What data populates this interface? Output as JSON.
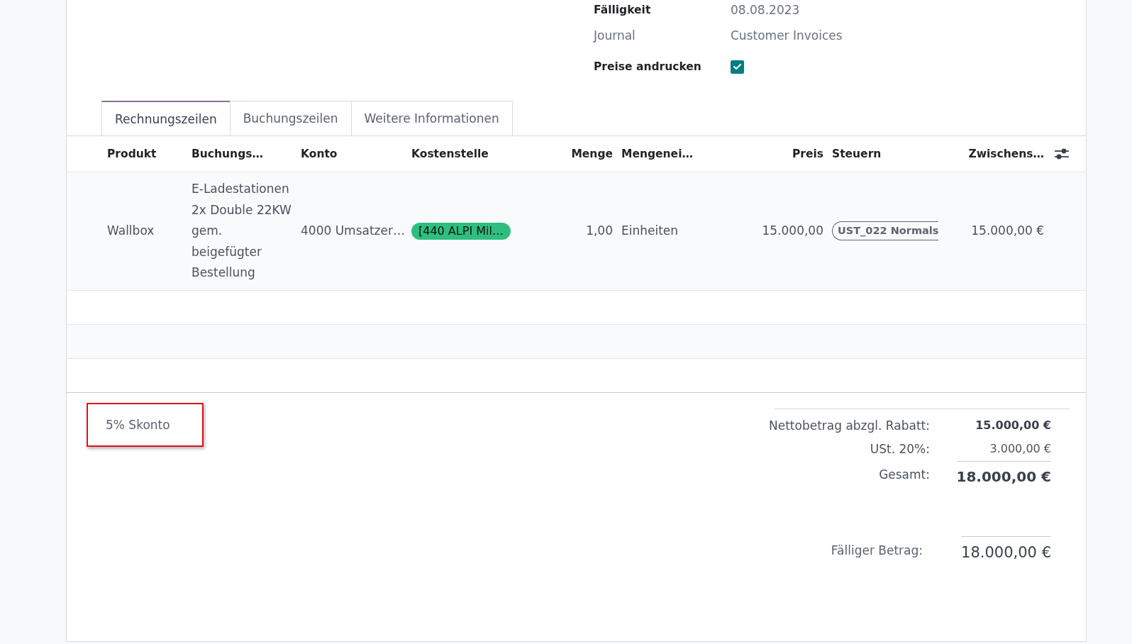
{
  "form_fields": [
    {
      "kind": "text",
      "label": "Fälligkeit",
      "value": "08.08.2023",
      "readonly": false
    },
    {
      "kind": "text",
      "label": "Journal",
      "value": "Customer Invoices",
      "readonly": true
    },
    {
      "kind": "checkbox",
      "label": "Preise andrucken",
      "checked": true,
      "readonly": false
    }
  ],
  "tabs": [
    {
      "label": "Rechnungszeilen",
      "selected": true
    },
    {
      "label": "Buchungszeilen",
      "selected": false
    },
    {
      "label": "Weitere Informationen",
      "selected": false
    }
  ],
  "table": {
    "columns": [
      {
        "label": "Produkt",
        "kind": "text"
      },
      {
        "label": "Buchungs…",
        "kind": "text"
      },
      {
        "label": "Konto",
        "kind": "text"
      },
      {
        "label": "Kostenstelle",
        "kind": "text"
      },
      {
        "label": "Menge",
        "kind": "number"
      },
      {
        "label": "Mengenei…",
        "kind": "text"
      },
      {
        "label": "Preis",
        "kind": "number"
      },
      {
        "label": "Steuern",
        "kind": "text"
      },
      {
        "label": "Zwischens…",
        "kind": "number"
      }
    ],
    "rows": [
      {
        "cells": [
          {
            "kind": "text",
            "text": "Wallbox"
          },
          {
            "kind": "text",
            "text": "E-Ladestationen 2x Double 22KW gem. beigefügter Bestellung"
          },
          {
            "kind": "text",
            "text": "4000 Umsatzer…"
          },
          {
            "kind": "color_tag",
            "text": "[440 ALPI Mil…",
            "color": "#2ebf7f"
          },
          {
            "kind": "number",
            "text": "1,00"
          },
          {
            "kind": "text",
            "text": "Einheiten"
          },
          {
            "kind": "number",
            "text": "15.000,00"
          },
          {
            "kind": "outline_tag",
            "text": "UST_022 Normals"
          },
          {
            "kind": "number",
            "text": "15.000,00 €"
          }
        ]
      }
    ]
  },
  "terms": {
    "text": "5% Skonto",
    "highlighted": true
  },
  "totals": [
    {
      "kind": "subtotal",
      "label": "Nettobetrag abzgl. Rabatt:",
      "value": "15.000,00 €"
    },
    {
      "kind": "tax",
      "label": "USt. 20%:",
      "value": "3.000,00 €"
    },
    {
      "kind": "total",
      "label": "Gesamt:",
      "value": "18.000,00 €"
    }
  ],
  "amount_due": {
    "label": "Fälliger Betrag:",
    "value": "18.000,00 €"
  }
}
